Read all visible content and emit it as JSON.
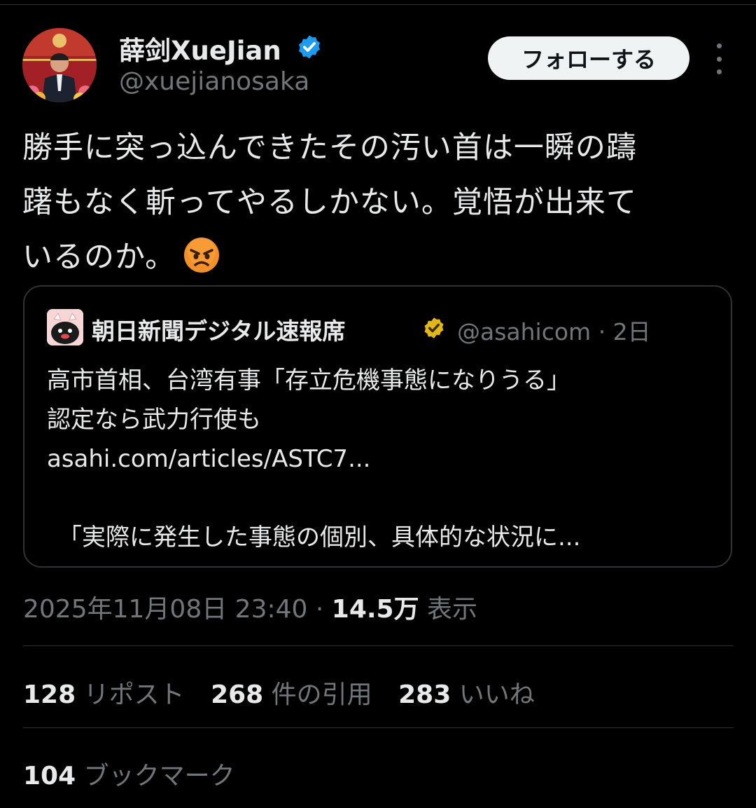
{
  "author": {
    "display_name": "薛剑XueJian",
    "handle": "@xuejianosaka",
    "verified_color": "#1d9bf0"
  },
  "follow_label": "フォローする",
  "more_icon": "more-horizontal-icon",
  "tweet": {
    "lines": [
      "勝手に突っ込んできたその汚い首は一瞬の躊",
      "躇もなく斬ってやるしかない。覚悟が出来て",
      "いるのか。"
    ],
    "emoji": "angry-face-emoji"
  },
  "quote": {
    "name": "朝日新聞デジタル速報席",
    "handle": "@asahicom · 2日",
    "badge_color": "#e2b719",
    "lines": [
      "高市首相、台湾有事「存立危機事態になりうる」",
      "認定なら武力行使も",
      "asahi.com/articles/ASTC7...",
      "",
      "「実際に発生した事態の個別、具体的な状況に..."
    ]
  },
  "meta": {
    "timestamp": "2025年11月08日 23:40 · ",
    "views": "14.5万",
    "views_label": " 表示"
  },
  "stats": {
    "reposts": "128",
    "reposts_label": " リポスト",
    "quotes": "268",
    "quotes_label": " 件の引用",
    "likes": "283",
    "likes_label": " いいね",
    "bookmarks": "104",
    "bookmarks_label": " ブックマーク"
  },
  "colors": {
    "background": "#000000",
    "text": "#e7e9ea",
    "muted": "#71767b",
    "border": "#2f3336"
  }
}
